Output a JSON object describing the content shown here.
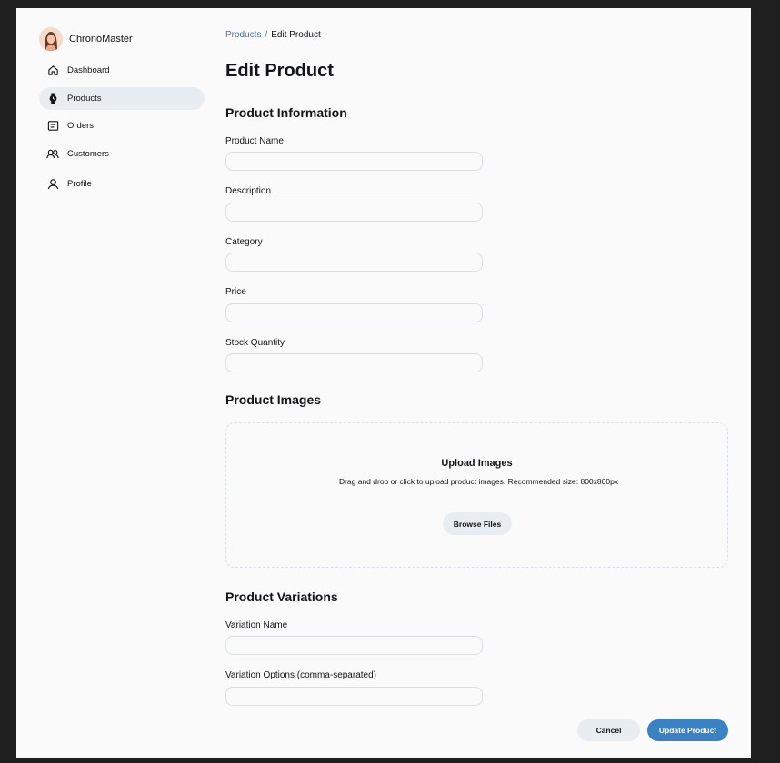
{
  "brand": {
    "name": "ChronoMaster"
  },
  "sidebar": {
    "items": [
      {
        "label": "Dashboard",
        "icon": "home-icon",
        "active": false
      },
      {
        "label": "Products",
        "icon": "watch-icon",
        "active": true
      },
      {
        "label": "Orders",
        "icon": "receipt-icon",
        "active": false
      },
      {
        "label": "Customers",
        "icon": "users-icon",
        "active": false
      },
      {
        "label": "Profile",
        "icon": "user-icon",
        "active": false
      }
    ]
  },
  "breadcrumb": {
    "parent": "Products",
    "separator": "/",
    "current": "Edit Product"
  },
  "page": {
    "title": "Edit Product"
  },
  "product_info": {
    "title": "Product Information",
    "fields": {
      "name": {
        "label": "Product Name",
        "value": ""
      },
      "description": {
        "label": "Description",
        "value": ""
      },
      "category": {
        "label": "Category",
        "value": ""
      },
      "price": {
        "label": "Price",
        "value": ""
      },
      "stock": {
        "label": "Stock Quantity",
        "value": ""
      }
    }
  },
  "images": {
    "title": "Product Images",
    "upload_title": "Upload Images",
    "upload_hint": "Drag and drop or click to upload product images. Recommended size: 800x800px",
    "browse_label": "Browse Files"
  },
  "variations": {
    "title": "Product Variations",
    "name_label": "Variation Name",
    "name_value": "",
    "options_label": "Variation Options (comma-separated)",
    "options_value": ""
  },
  "actions": {
    "cancel_label": "Cancel",
    "update_label": "Update Product"
  },
  "colors": {
    "accent": "#3b82c4",
    "muted_bg": "#e8edf2",
    "link": "#4f7396",
    "border": "#dbe0e5"
  }
}
